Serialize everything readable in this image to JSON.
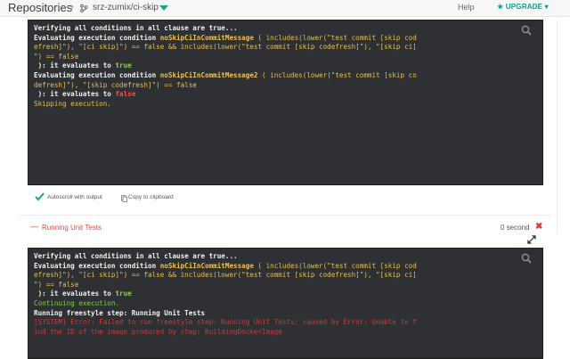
{
  "header": {
    "repositories_label": "Repositories",
    "breadcrumb_separator": "›",
    "repo_name": "srz-zumix/ci-skip",
    "help_label": "Help",
    "upgrade_label": "★ UPGRADE ▾",
    "accent_color": "#1aa38a"
  },
  "log1": {
    "l1": "Verifying all conditions in all clause are true...",
    "l2a": "Evaluating execution condition ",
    "l2b": "noSkipCiInCommitMessage",
    "l2c": " ( includes(lower(\"test commit [skip cod",
    "l3": "efresh]\"), \"[ci skip]\") == false && includes(lower(\"test commit [skip codefresh]\"), \"[skip ci]",
    "l4": "\") == false",
    "l5a": " ): it evaluates to ",
    "l5b": "true",
    "l6a": "Evaluating execution condition ",
    "l6b": "noSkipCiInCommitMessage2",
    "l6c": " ( includes(lower(\"test commit [skip co",
    "l7": "defresh]\"), \"[skip codefresh]\") == false",
    "l8a": " ): it evaluates to ",
    "l8b": "false",
    "l9": "Skipping execution."
  },
  "toolbar": {
    "autoscroll_label": "Autoscroll with output",
    "copy_label": "Copy to clipboard"
  },
  "step": {
    "dash": "—",
    "name": "Running Unit Tests",
    "duration": "0 second",
    "close": "✖"
  },
  "log2": {
    "l1": "Verifying all conditions in all clause are true...",
    "l2a": "Evaluating execution condition ",
    "l2b": "noSkipCiInCommitMessage",
    "l2c": " ( includes(lower(\"test commit [skip cod",
    "l3": "efresh]\"), \"[ci skip]\") == false && includes(lower(\"test commit [skip codefresh]\"), \"[skip ci]",
    "l4": "\") == false",
    "l5a": " ): it evaluates to ",
    "l5b": "true",
    "l6": "Continuing execution.",
    "l7": "Running freestyle step: Running Unit Tests",
    "l8": "[SYSTEM] Error: Failed to run freestyle step: Running Unit Tests; caused by Error: Unable to f",
    "l9": "ind the ID of the image produced by step: BuildingDockerImage"
  }
}
